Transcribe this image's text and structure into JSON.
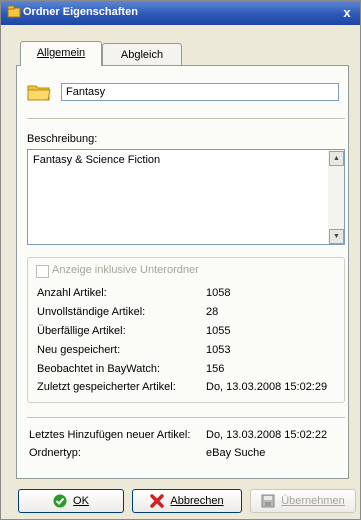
{
  "window": {
    "title": "Ordner Eigenschaften",
    "close_glyph": "x"
  },
  "tabs": [
    {
      "label": "Allgemein",
      "active": true
    },
    {
      "label": "Abgleich",
      "active": false
    }
  ],
  "name_field": {
    "value": "Fantasy",
    "icon": "folder-icon"
  },
  "description": {
    "label": "Beschreibung:",
    "text": "Fantasy & Science Fiction"
  },
  "subfolders_checkbox": {
    "label": "Anzeige inklusive Unterordner",
    "checked": false,
    "enabled": false
  },
  "stats": [
    {
      "label": "Anzahl Artikel:",
      "value": "1058"
    },
    {
      "label": "Unvollständige Artikel:",
      "value": "28"
    },
    {
      "label": "Überfällige Artikel:",
      "value": "1055"
    },
    {
      "label": "Neu gespeichert:",
      "value": "1053"
    },
    {
      "label": "Beobachtet in BayWatch:",
      "value": "156"
    },
    {
      "label": "Zuletzt gespeicherter Artikel:",
      "value": "Do, 13.03.2008 15:02:29"
    }
  ],
  "info": [
    {
      "label": "Letztes Hinzufügen neuer Artikel:",
      "value": "Do, 13.03.2008 15:02:22"
    },
    {
      "label": "Ordnertyp:",
      "value": "eBay Suche"
    }
  ],
  "buttons": {
    "ok": {
      "label": "OK",
      "icon": "check-icon"
    },
    "cancel": {
      "label": "Abbrechen",
      "icon": "cross-icon"
    },
    "apply": {
      "label": "Übernehmen",
      "icon": "save-icon",
      "enabled": false
    }
  },
  "colors": {
    "accent": "#2c58b8",
    "ok_green": "#2a9a2a",
    "cancel_red": "#d42020"
  }
}
